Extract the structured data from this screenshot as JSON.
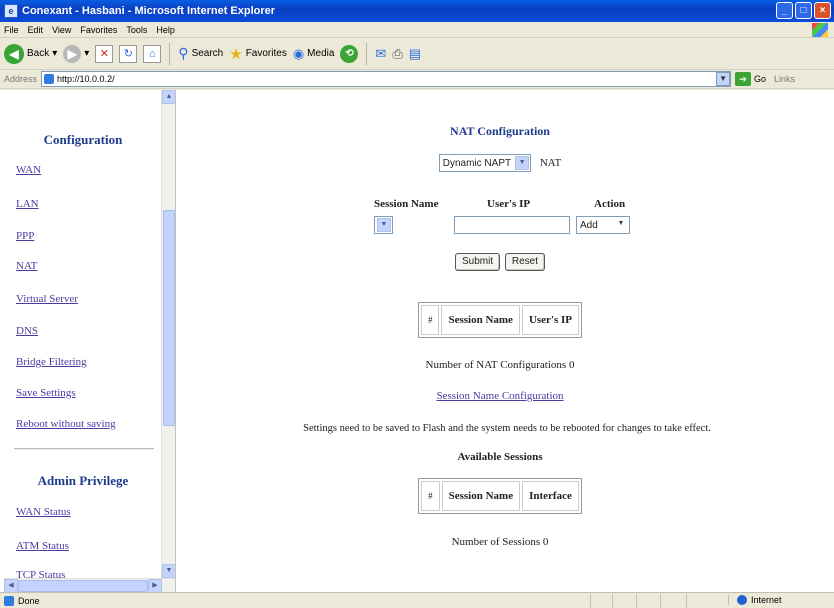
{
  "window": {
    "title": "Conexant - Hasbani - Microsoft Internet Explorer"
  },
  "menu": [
    "File",
    "Edit",
    "View",
    "Favorites",
    "Tools",
    "Help"
  ],
  "toolbar": {
    "back": "Back",
    "search": "Search",
    "favorites": "Favorites",
    "media": "Media"
  },
  "address": {
    "label": "Address",
    "url": "http://10.0.0.2/",
    "go": "Go",
    "links": "Links"
  },
  "sidebar": {
    "config_heading": "Configuration",
    "config_items": [
      "WAN",
      "LAN",
      "PPP",
      "NAT",
      "Virtual Server",
      "DNS",
      "Bridge Filtering",
      "Save Settings",
      "Reboot without saving"
    ],
    "admin_heading": "Admin Privilege",
    "admin_items": [
      "WAN Status",
      "ATM Status",
      "TCP Status"
    ]
  },
  "main": {
    "title": "NAT Configuration",
    "nat_mode": "Dynamic NAPT",
    "nat_label": "NAT",
    "form": {
      "session_name_label": "Session Name",
      "users_ip_label": "User's IP",
      "action_label": "Action",
      "session_name_value": "",
      "users_ip_value": "",
      "action_value": "Add",
      "submit": "Submit",
      "reset": "Reset"
    },
    "nat_table": {
      "headers": [
        "#",
        "Session Name",
        "User's IP"
      ]
    },
    "nat_count_text": "Number of NAT Configurations 0",
    "session_link": "Session Name Configuration",
    "notice": "Settings need to be saved to Flash and the system needs to be rebooted for changes to take effect.",
    "sessions_title": "Available Sessions",
    "sessions_table": {
      "headers": [
        "#",
        "Session Name",
        "Interface"
      ]
    },
    "sessions_count_text": "Number of Sessions 0"
  },
  "status": {
    "text": "Done",
    "zone": "Internet"
  }
}
